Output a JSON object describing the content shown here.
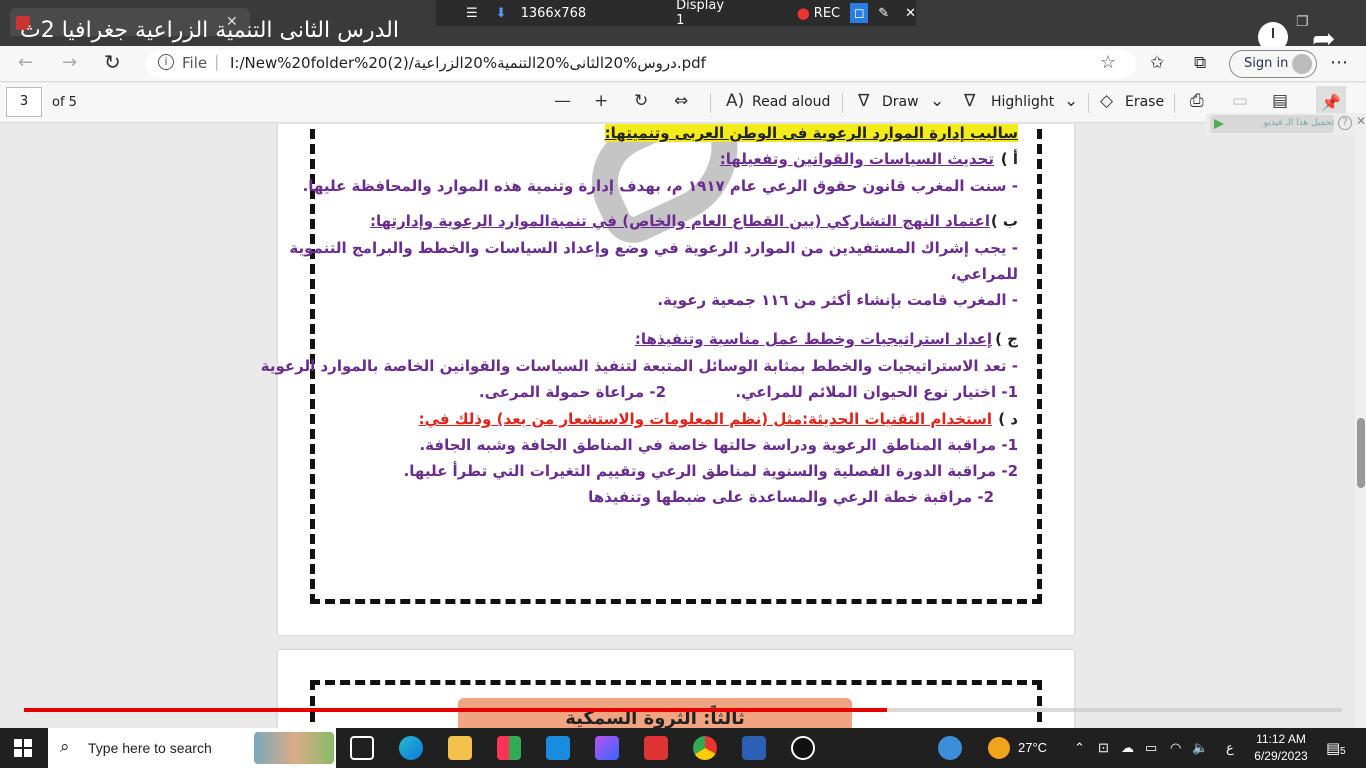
{
  "video": {
    "title": "الدرس الثانى التنمية الزراعية جغرافيا 2ث",
    "recorder": {
      "resolution": "1366x768",
      "display": "Display 1",
      "rec_label": "REC"
    },
    "progress_fraction": 0.655
  },
  "browser": {
    "url_scheme_label": "File",
    "url": "I:/New%20folder%20(2)/دروس%20الثانى%20التنمية%20الزراعية.pdf",
    "signin_label": "Sign in"
  },
  "pdf_toolbar": {
    "current_page": "3",
    "page_count_label": "of 5",
    "read_aloud": "Read aloud",
    "draw": "Draw",
    "highlight": "Highlight",
    "erase": "Erase"
  },
  "side_widget": {
    "download_video": "تحميل هذا الـ فيديو"
  },
  "document": {
    "heading": "ساليب إدارة الموارد الرعوية فى الوطن العربى وتنميتها:",
    "a_label": "أ )",
    "a_title": "تحديث السياسات والقوانين وتفعيلها:",
    "a_line1": "- سنت المغرب قانون حقوق الرعي عام ١٩١٧ م، بهدف إدارة وتنمية هذه الموارد والمحافظة عليها.",
    "b_label": "ب )",
    "b_title": "اعتماد النهج التشاركي (بين القطاع العام والخاص) في تنميةالموارد الرعوية وإدارتها:",
    "b_line1": "- يجب إشراك المستفيدين من الموارد الرعوية في وضع وإعداد السياسات والخطط والبرامج التنموية",
    "b_line2": "للمراعي،",
    "b_line3": "- المغرب  قامت بإنشاء أكثر من ١١٦ جمعية رعوية.",
    "c_label": "ج )",
    "c_title": "إعداد استراتيجيات وخطط عمل مناسبة وتنفيذها:",
    "c_line1": "- تعد الاستراتيجيات والخطط بمثابة الوسائل المتبعة لتنفيذ السياسات والقوانين الخاصة بالموارد الرعوية",
    "c_line2a": "1- اختيار نوع الحيوان الملائم للمراعي.",
    "c_line2b": "2- مراعاة حمولة المرعى.",
    "d_label": "د )",
    "d_title": "استخدام التقنيات الحديثة:مثل (نظم المعلومات والاستشعار من بعد) وذلك في:",
    "d_line1": "1- مراقبة المناطق الرعوية ودراسة حالتها خاصة في المناطق الجافة وشبه الجافة.",
    "d_line2": "2- مراقبة الدورة الفصلية والسنوية لمناطق الرعي وتقييم التغيرات التي تطرأ عليها.",
    "d_line3": "2- مراقبة خطة الرعي والمساعدة على ضبطها وتنفيذها",
    "page2_title": "ثالثاً: الثروة السمكية"
  },
  "taskbar": {
    "search_placeholder": "Type here to search",
    "weather": "27°C",
    "lang": "ع",
    "time": "11:12 AM",
    "date": "6/29/2023",
    "notif_count": "5"
  }
}
